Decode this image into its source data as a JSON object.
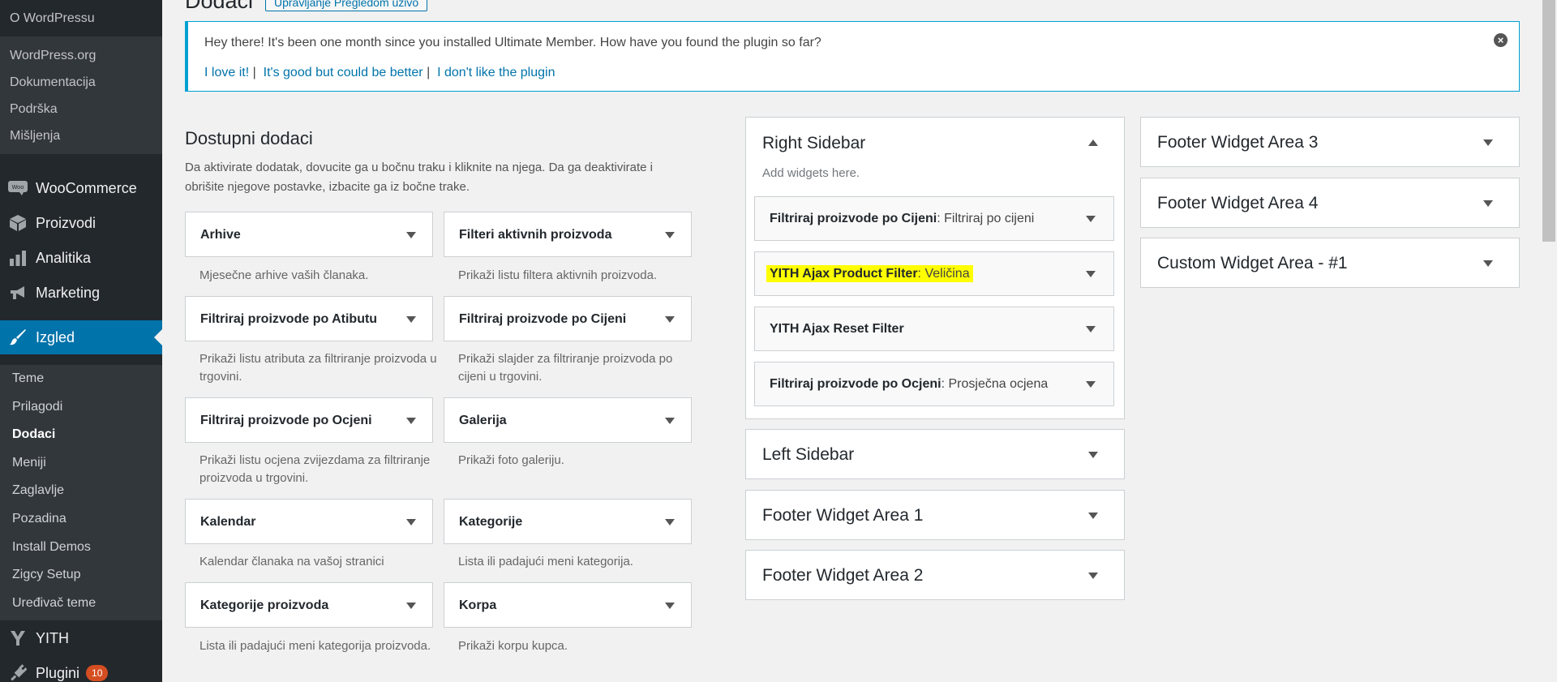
{
  "sidebar": {
    "top_items": [
      "O WordPressu"
    ],
    "wp_links": [
      "WordPress.org",
      "Dokumentacija",
      "Podrška",
      "Mišljenja"
    ],
    "menu": [
      {
        "label": "WooCommerce",
        "icon": "woocommerce-icon"
      },
      {
        "label": "Proizvodi",
        "icon": "box-icon"
      },
      {
        "label": "Analitika",
        "icon": "bar-chart-icon"
      },
      {
        "label": "Marketing",
        "icon": "megaphone-icon"
      },
      {
        "label": "Izgled",
        "icon": "paintbrush-icon"
      }
    ],
    "appearance_submenu": [
      "Teme",
      "Prilagodi",
      "Dodaci",
      "Meniji",
      "Zaglavlje",
      "Pozadina",
      "Install Demos",
      "Zigcy Setup",
      "Uređivač teme"
    ],
    "bottom_menu": [
      {
        "label": "YITH",
        "icon": "yith-icon"
      },
      {
        "label": "Plugini",
        "icon": "plugin-icon",
        "badge": "10"
      }
    ]
  },
  "header": {
    "title": "Dodaci",
    "manage_live": "Upravljanje Pregledom uživo"
  },
  "notice": {
    "message": "Hey there! It's been one month since you installed Ultimate Member. How have you found the plugin so far?",
    "love": "I love it!",
    "sep": "|",
    "good": "It's good but could be better",
    "dislike": "I don't like the plugin"
  },
  "available": {
    "title": "Dostupni dodaci",
    "description": "Da aktivirate dodatak, dovucite ga u bočnu traku i kliknite na njega. Da ga deaktivirate i obrišite njegove postavke, izbacite ga iz bočne trake.",
    "widgets": [
      {
        "title": "Arhive",
        "desc": "Mjesečne arhive vaših članaka."
      },
      {
        "title": "Filteri aktivnih proizvoda",
        "desc": "Prikaži listu filtera aktivnih proizvoda."
      },
      {
        "title": "Filtriraj proizvode po Atibutu",
        "desc": "Prikaži listu atributa za filtriranje proizvoda u trgovini."
      },
      {
        "title": "Filtriraj proizvode po Cijeni",
        "desc": "Prikaži slajder za filtriranje proizvoda po cijeni u trgovini."
      },
      {
        "title": "Filtriraj proizvode po Ocjeni",
        "desc": "Prikaži listu ocjena zvijezdama za filtriranje proizvoda u trgovini."
      },
      {
        "title": "Galerija",
        "desc": "Prikaži foto galeriju."
      },
      {
        "title": "Kalendar",
        "desc": "Kalendar članaka na vašoj stranici"
      },
      {
        "title": "Kategorije",
        "desc": "Lista ili padajući meni kategorija."
      },
      {
        "title": "Kategorije proizvoda",
        "desc": "Lista ili padajući meni kategorija proizvoda."
      },
      {
        "title": "Korpa",
        "desc": "Prikaži korpu kupca."
      }
    ]
  },
  "right_sidebar": {
    "title": "Right Sidebar",
    "empty_hint": "Add widgets here.",
    "widgets": [
      {
        "title": "Filtriraj proizvode po Cijeni",
        "sep": ":",
        "subtitle": "Filtriraj po cijeni"
      },
      {
        "title": "YITH Ajax Product Filter",
        "sep": ":",
        "subtitle": "Veličina"
      },
      {
        "title": "YITH Ajax Reset Filter"
      },
      {
        "title": "Filtriraj proizvode po Ocjeni",
        "sep": ":",
        "subtitle": "Prosječna ocjena"
      }
    ]
  },
  "widget_areas_col2": [
    "Left Sidebar",
    "Footer Widget Area 1",
    "Footer Widget Area 2"
  ],
  "widget_areas_col3": [
    "Footer Widget Area 3",
    "Footer Widget Area 4",
    "Custom Widget Area - #1"
  ],
  "colors": {
    "admin_dark": "#23282d",
    "accent": "#0073aa",
    "highlight": "#ffff00",
    "badge": "#d54e21"
  }
}
